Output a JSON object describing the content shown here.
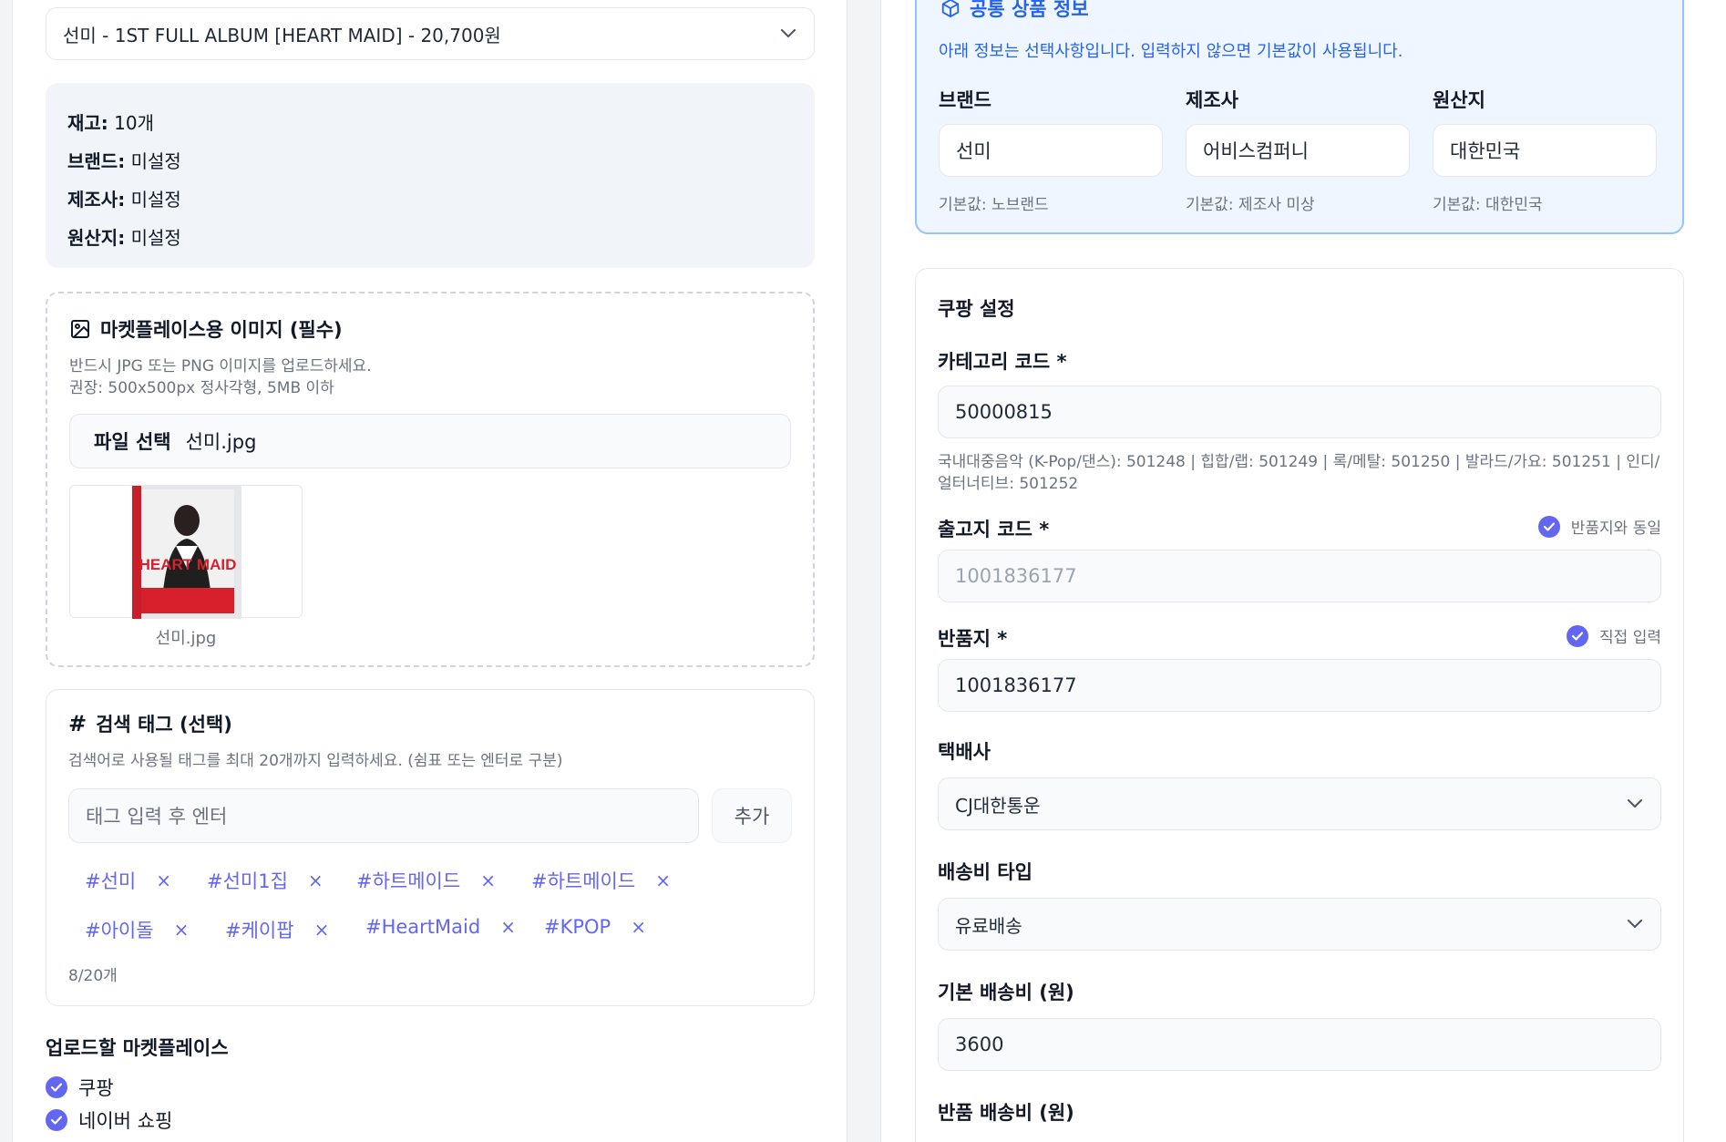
{
  "left": {
    "product_select": {
      "value": "선미 - 1ST FULL ALBUM [HEART MAID] - 20,700원"
    },
    "info": {
      "stock_label": "재고:",
      "stock_value": "10개",
      "brand_label": "브랜드:",
      "brand_value": "미설정",
      "maker_label": "제조사:",
      "maker_value": "미설정",
      "origin_label": "원산지:",
      "origin_value": "미설정"
    },
    "image_section": {
      "title": "마켓플레이스용 이미지 (필수)",
      "help1": "반드시 JPG 또는 PNG 이미지를 업로드하세요.",
      "help2": "권장: 500x500px 정사각형, 5MB 이하",
      "file_button": "파일 선택",
      "file_name": "선미.jpg",
      "thumb_caption": "선미.jpg",
      "thumb_art_text": "HEART MAID",
      "icon": "image-icon"
    },
    "tags_section": {
      "title": "검색 태그 (선택)",
      "help": "검색어로 사용될 태그를 최대 20개까지 입력하세요. (쉼표 또는 엔터로 구분)",
      "input_placeholder": "태그 입력 후 엔터",
      "add_label": "추가",
      "remove_glyph": "×",
      "tags": [
        "#선미",
        "#선미1집",
        "#하트메이드",
        "#하트메이드",
        "#아이돌",
        "#케이팝",
        "#HeartMaid",
        "#KPOP"
      ],
      "count": "8/20개",
      "icon": "hash-icon"
    },
    "marketplaces": {
      "title": "업로드할 마켓플레이스",
      "items": [
        {
          "label": "쿠팡",
          "checked": true
        },
        {
          "label": "네이버 쇼핑",
          "checked": true
        }
      ]
    }
  },
  "right": {
    "common_info": {
      "title": "공통 상품 정보",
      "subtitle": "아래 정보는 선택사항입니다. 입력하지 않으면 기본값이 사용됩니다.",
      "icon": "box-icon",
      "columns": [
        {
          "label": "브랜드",
          "value": "선미",
          "default": "기본값: 노브랜드"
        },
        {
          "label": "제조사",
          "value": "어비스컴퍼니",
          "default": "기본값: 제조사 미상"
        },
        {
          "label": "원산지",
          "value": "대한민국",
          "default": "기본값: 대한민국"
        }
      ]
    },
    "coupang": {
      "title": "쿠팡 설정",
      "category_label": "카테고리 코드 *",
      "category_value": "50000815",
      "category_help1": "국내대중음악 (K-Pop/댄스): 501248 | 힙합/랩: 501249 | 록/메탈: 501250 | 발라드/가요: 501251 | 인디/",
      "category_help2": "얼터너티브: 501252",
      "outbound_label": "출고지 코드 *",
      "outbound_check_label": "반품지와 동일",
      "outbound_value": "1001836177",
      "return_label": "반품지 *",
      "return_check_label": "직접 입력",
      "return_value": "1001836177",
      "courier_label": "택배사",
      "courier_value": "CJ대한통운",
      "shipping_type_label": "배송비 타입",
      "shipping_type_value": "유료배송",
      "base_fee_label": "기본 배송비 (원)",
      "base_fee_value": "3600",
      "return_fee_label": "반품 배송비 (원)"
    }
  },
  "colors": {
    "accent": "#6366f1",
    "blue": "#2563eb",
    "blue_bg": "#eff6ff",
    "blue_border": "#93c5fd"
  }
}
